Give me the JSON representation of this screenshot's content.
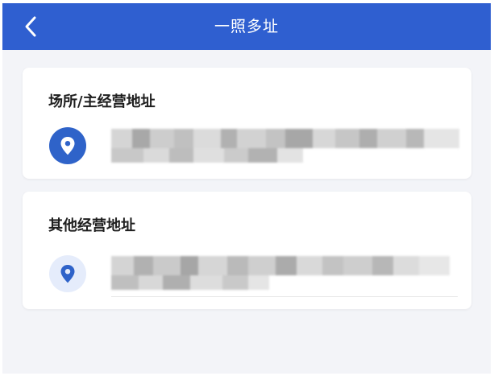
{
  "header": {
    "title": "一照多址",
    "background": "#2f5fd0",
    "back_icon": "chevron-left-icon"
  },
  "sections": [
    {
      "title": "场所/主经营地址",
      "icon": "location-pin-icon",
      "icon_style": "filled-blue",
      "address": ""
    },
    {
      "title": "其他经营地址",
      "icon": "location-pin-icon",
      "icon_style": "light-blue",
      "address": ""
    }
  ]
}
